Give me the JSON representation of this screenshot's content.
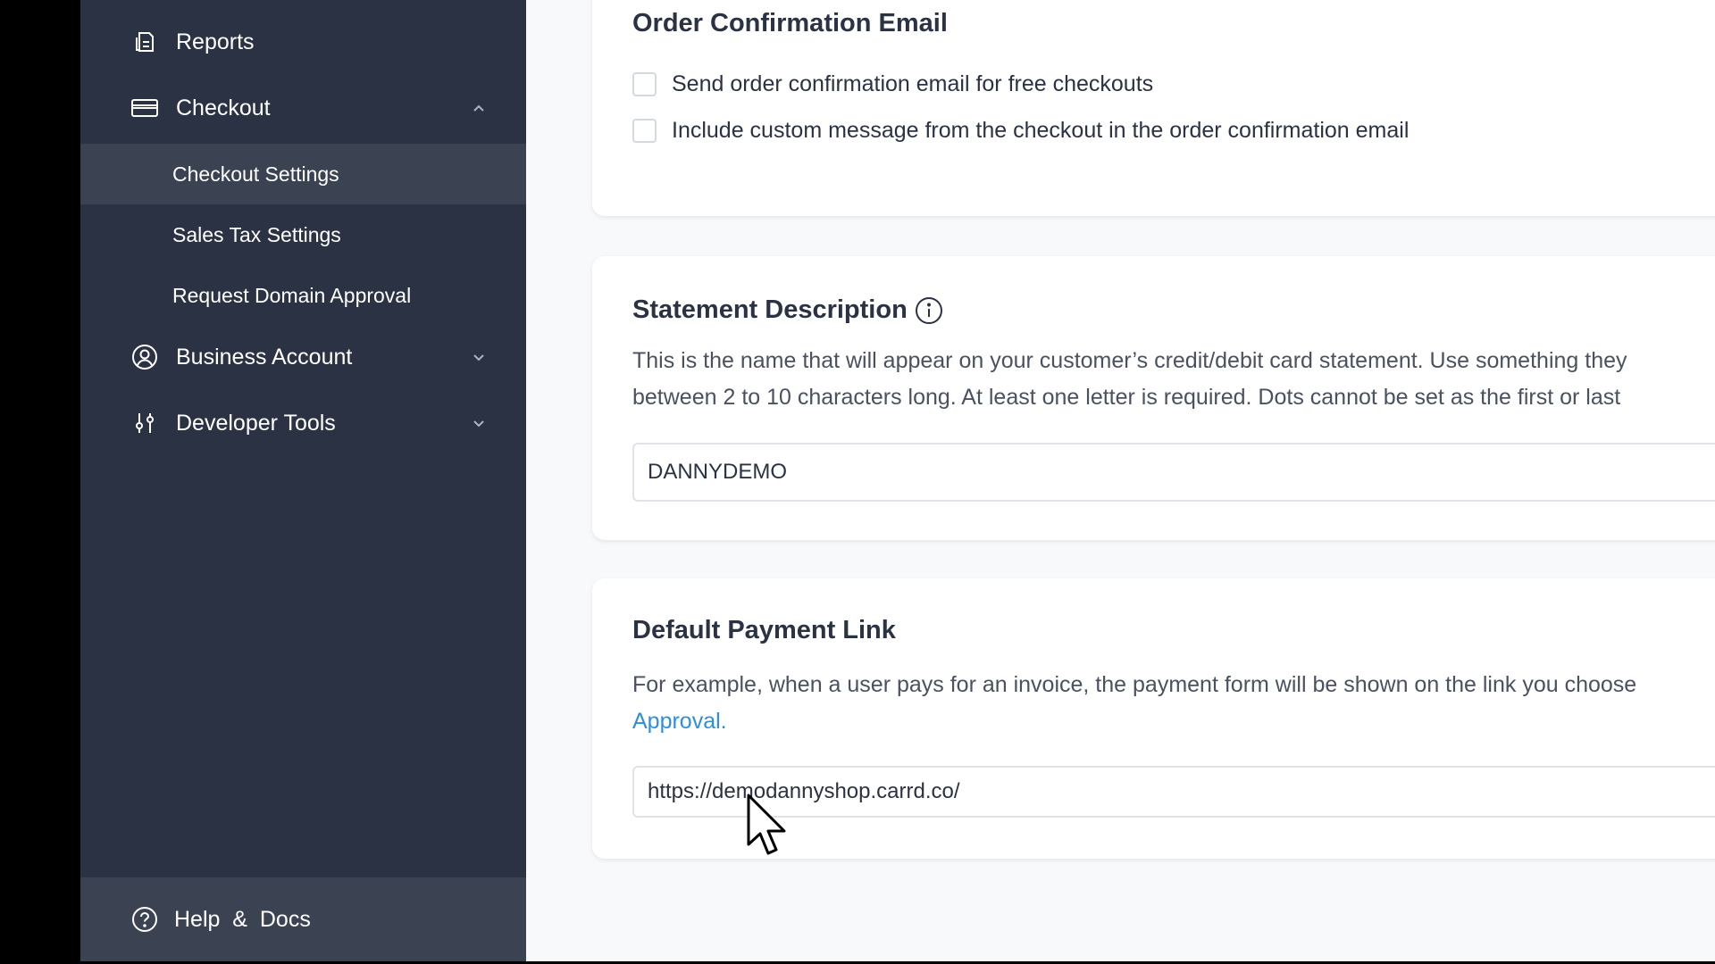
{
  "sidebar": {
    "items": [
      {
        "label": "Reports",
        "icon": "reports-icon"
      },
      {
        "label": "Checkout",
        "icon": "credit-card-icon",
        "expanded": true
      },
      {
        "label": "Business Account",
        "icon": "user-circle-icon",
        "expanded": false
      },
      {
        "label": "Developer Tools",
        "icon": "sliders-icon",
        "expanded": false
      }
    ],
    "checkout_sub": [
      {
        "label": "Checkout Settings",
        "active": true
      },
      {
        "label": "Sales Tax Settings"
      },
      {
        "label": "Request Domain Approval"
      }
    ],
    "help": {
      "label": "Help  &  Docs",
      "icon": "help-circle-icon"
    }
  },
  "order_email": {
    "title": "Order Confirmation Email",
    "options": [
      {
        "label": "Send order confirmation email for free checkouts",
        "checked": false
      },
      {
        "label": "Include custom message from the checkout in the order confirmation email",
        "checked": false
      }
    ]
  },
  "statement": {
    "title": "Statement Description",
    "desc_line1": "This is the name that will appear on your customer’s credit/debit card statement. Use something they",
    "desc_line2": "between 2 to 10 characters long. At least one letter is required. Dots cannot be set as the first or last",
    "value": "DANNYDEMO"
  },
  "payment_link": {
    "title": "Default Payment Link",
    "desc_line1": "For example, when a user pays for an invoice, the payment form will be shown on the link you choose",
    "link_text": "Approval.",
    "value": "https://demodannyshop.carrd.co/"
  },
  "colors": {
    "sidebar_bg": "#2b3243",
    "sidebar_active": "#3b4252",
    "link": "#2f8fdb"
  }
}
